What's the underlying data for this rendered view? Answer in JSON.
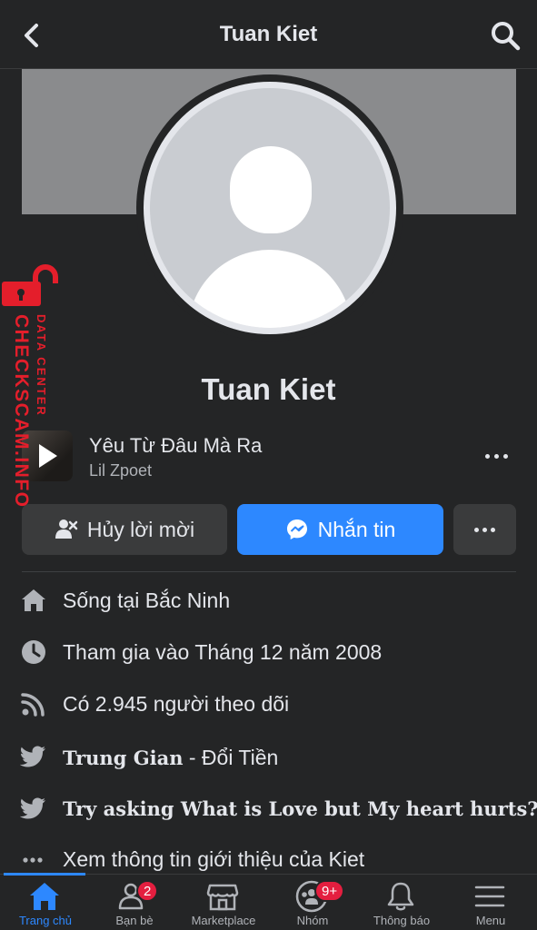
{
  "header": {
    "title": "Tuan Kiet"
  },
  "profile": {
    "name": "Tuan Kiet"
  },
  "music": {
    "song": "Yêu Từ Đâu Mà Ra",
    "artist": "Lil Zpoet"
  },
  "actions": {
    "cancel_label": "Hủy lời mời",
    "message_label": "Nhắn tin"
  },
  "info": [
    {
      "icon": "home-icon",
      "text": "Sống tại Bắc Ninh"
    },
    {
      "icon": "clock-icon",
      "text": "Tham gia vào Tháng 12 năm 2008"
    },
    {
      "icon": "rss-icon",
      "text": "Có 2.945 người theo dõi"
    },
    {
      "icon": "twitter-icon",
      "text_bold": "Trung Gian",
      "text_rest": " - Đổi Tiền"
    },
    {
      "icon": "twitter-icon",
      "text": "Try asking What is Love but My heart hurts?"
    },
    {
      "icon": "more-dots-icon",
      "text": "Xem thông tin giới thiệu của Kiet"
    }
  ],
  "tabs": [
    {
      "label": "Trang chủ",
      "active": true
    },
    {
      "label": "Bạn bè",
      "badge": "2"
    },
    {
      "label": "Marketplace"
    },
    {
      "label": "Nhóm",
      "badge": "9+"
    },
    {
      "label": "Thông báo"
    },
    {
      "label": "Menu"
    }
  ],
  "watermark": {
    "line1": "DATA CENTER",
    "line2": "CHECKSCAM.INFO"
  },
  "colors": {
    "background": "#242526",
    "accent": "#2d88ff",
    "badge": "#e41e3f",
    "watermark": "#e41e2b"
  }
}
